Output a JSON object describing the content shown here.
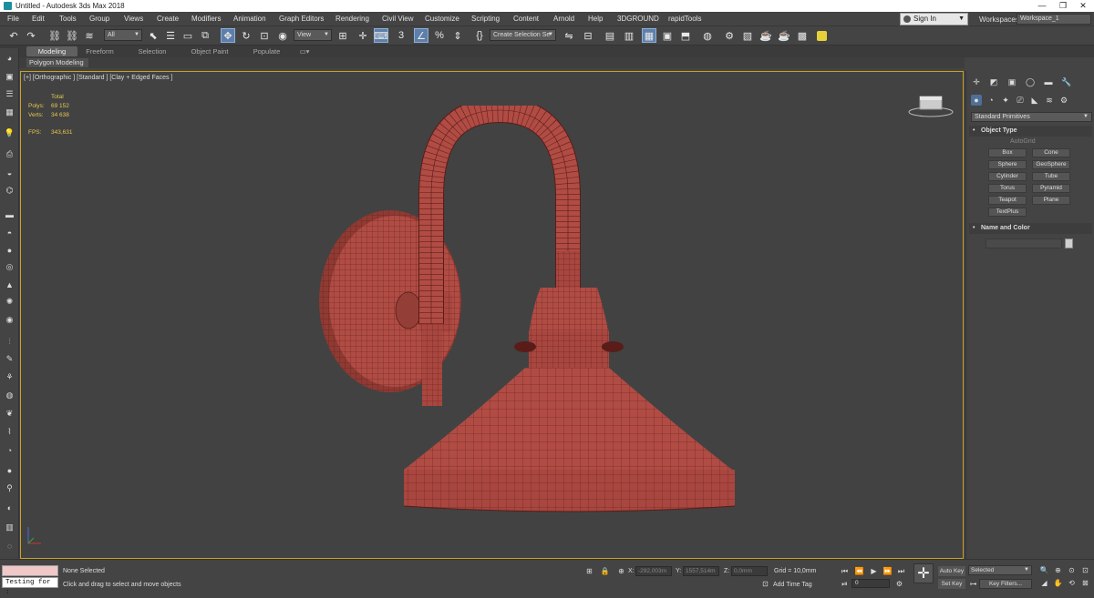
{
  "window": {
    "title": "Untitled - Autodesk 3ds Max 2018",
    "controls": [
      "—",
      "❐",
      "✕"
    ]
  },
  "menubar": {
    "items": [
      "File",
      "Edit",
      "Tools",
      "Group",
      "Views",
      "Create",
      "Modifiers",
      "Animation",
      "Graph Editors",
      "Rendering",
      "Civil View",
      "Customize",
      "Scripting",
      "Content",
      "Arnold",
      "Help",
      "3DGROUND",
      "rapidTools"
    ]
  },
  "account": {
    "sign_in": "Sign In",
    "workspaces_label": "Workspaces:",
    "workspace": "Workspace_1"
  },
  "toolbar": {
    "filter": "All",
    "ref_coord": "View",
    "selection_set": "Create Selection Se",
    "snap_label": "3",
    "percent_label": "%"
  },
  "ribbon": {
    "tabs": [
      "Modeling",
      "Freeform",
      "Selection",
      "Object Paint",
      "Populate"
    ],
    "active_tab": "Modeling",
    "sub_label": "Polygon Modeling"
  },
  "viewport": {
    "label": "[+] [Orthographic ] [Standard ] [Clay + Edged Faces ]",
    "stats": {
      "total_label": "Total",
      "polys_label": "Polys:",
      "polys": "69 152",
      "verts_label": "Verts:",
      "verts": "34 638",
      "fps_label": "FPS:",
      "fps": "343,631"
    },
    "mesh_color": "#b04c44",
    "wire_color": "#5a1c18",
    "border_color": "#c9a227"
  },
  "command_panel": {
    "category": "Standard Primitives",
    "object_type_title": "Object Type",
    "autogrid": "AutoGrid",
    "buttons": [
      "Box",
      "Cone",
      "Sphere",
      "GeoSphere",
      "Cylinder",
      "Tube",
      "Torus",
      "Pyramid",
      "Teapot",
      "Plane",
      "TextPlus"
    ],
    "name_color_title": "Name and Color"
  },
  "statusbar": {
    "maxscript_input": "Testing for :",
    "selection": "None Selected",
    "hint": "Click and drag to select and move objects",
    "x_label": "X:",
    "x_value": "-292,003m",
    "y_label": "Y:",
    "y_value": "1557,514m",
    "z_label": "Z:",
    "z_value": "0,0mm",
    "grid": "Grid = 10,0mm",
    "add_time_tag": "Add Time Tag",
    "frame": "0",
    "auto_key": "Auto Key",
    "set_key": "Set Key",
    "selected": "Selected",
    "key_filters": "Key Filters..."
  }
}
